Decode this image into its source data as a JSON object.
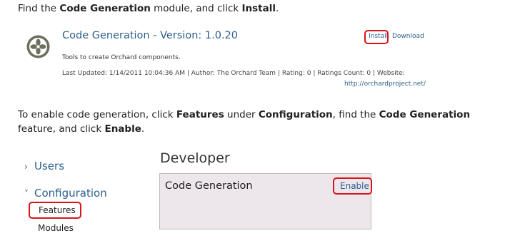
{
  "instructions": {
    "step1": {
      "pre": "Find the ",
      "module": "Code Generation",
      "mid": " module, and click ",
      "action": "Install",
      "post": "."
    },
    "step2": {
      "pre": "To enable code generation, click ",
      "features": "Features",
      "under": " under ",
      "configuration": "Configuration",
      "find": ", find the ",
      "feature": "Code Generation",
      "feature_post": " feature, and click ",
      "enable": "Enable",
      "post": "."
    }
  },
  "module": {
    "icon": "orchard-logo-icon",
    "title": "Code Generation - Version: 1.0.20",
    "description": "Tools to create Orchard components.",
    "meta": "Last Updated: 1/14/2011 10:04:36 AM | Author: The Orchard Team | Rating: 0 | Ratings Count: 0 | Website:",
    "website": "http://orchardproject.net/",
    "install_label": "Install",
    "download_label": "Download"
  },
  "nav": {
    "users": "Users",
    "configuration": "Configuration",
    "features": "Features",
    "modules": "Modules",
    "chevron_collapsed": "›",
    "chevron_expanded": "˅"
  },
  "developer": {
    "heading": "Developer",
    "feature_name": "Code Generation",
    "enable_label": "Enable"
  },
  "colors": {
    "link": "#2c5f8b",
    "highlight": "#d9141c",
    "panel_bg": "#ede7eb"
  }
}
